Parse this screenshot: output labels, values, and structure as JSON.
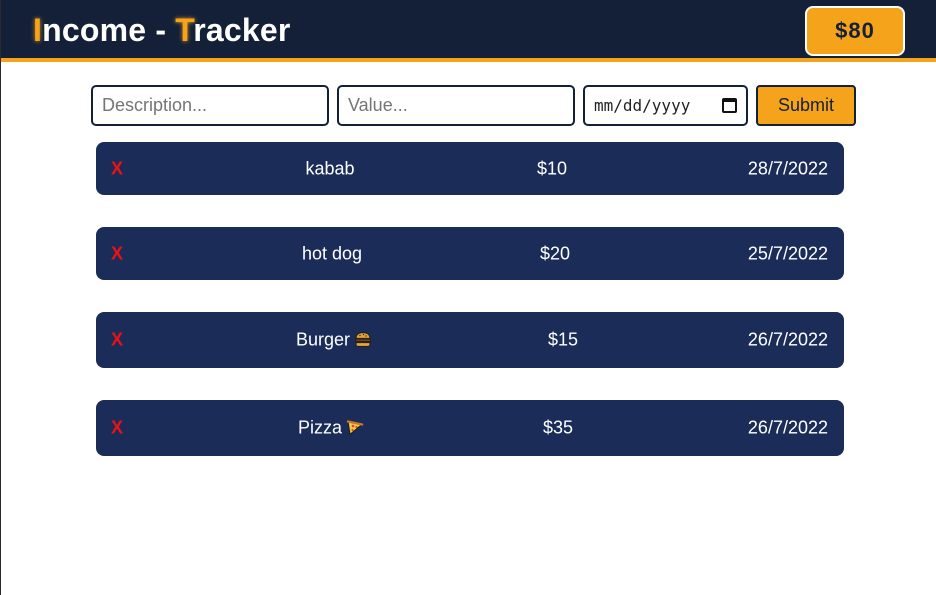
{
  "header": {
    "title_first_letter": "I",
    "title_rest_1": "ncome - ",
    "title_second_letter": "T",
    "title_rest_2": "racker",
    "total": "$80"
  },
  "form": {
    "description_placeholder": "Description...",
    "value_placeholder": "Value...",
    "date_placeholder": "mm/dd/yyyy",
    "submit_label": "Submit"
  },
  "entries": [
    {
      "delete_label": "X",
      "description": "kabab",
      "emoji": "",
      "amount": "$10",
      "date": "28/7/2022"
    },
    {
      "delete_label": "X",
      "description": "hot dog",
      "emoji": "",
      "amount": "$20",
      "date": "25/7/2022"
    },
    {
      "delete_label": "X",
      "description": "Burger",
      "emoji": "burger-icon",
      "amount": "$15",
      "date": "26/7/2022"
    },
    {
      "delete_label": "X",
      "description": "Pizza",
      "emoji": "pizza-icon",
      "amount": "$35",
      "date": "26/7/2022"
    }
  ],
  "colors": {
    "header_bg": "#142038",
    "accent": "#f5a31a",
    "row_bg": "#1c2c58",
    "delete": "#ee1111"
  }
}
